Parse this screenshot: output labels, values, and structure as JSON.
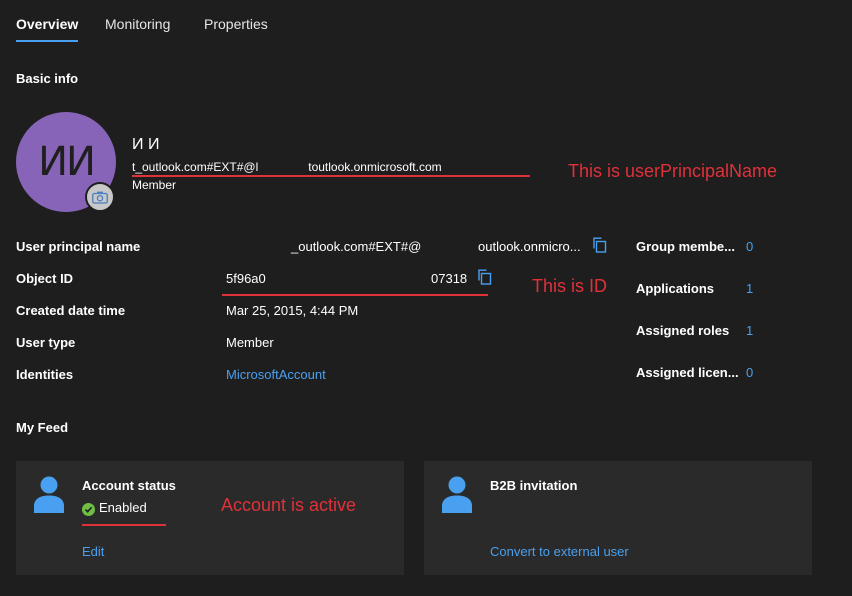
{
  "tabs": [
    {
      "label": "Overview",
      "active": true
    },
    {
      "label": "Monitoring",
      "active": false
    },
    {
      "label": "Properties",
      "active": false
    }
  ],
  "basic_info": {
    "title": "Basic info",
    "avatar_initials": "ИИ",
    "display_name": "И                И",
    "upn_line": "t_outlook.com#EXT#@l               toutlook.onmicrosoft.com",
    "user_type_line": "Member"
  },
  "fields": [
    {
      "label": "User principal name",
      "value_a": "_outlook.com#EXT#@",
      "value_b": "outlook.onmicro..."
    },
    {
      "label": "Object ID",
      "value_a": "5f96a0",
      "value_b": "07318"
    },
    {
      "label": "Created date time",
      "value": "Mar 25, 2015, 4:44 PM"
    },
    {
      "label": "User type",
      "value": "Member"
    },
    {
      "label": "Identities",
      "value": "MicrosoftAccount"
    }
  ],
  "stats": [
    {
      "label": "Group membe...",
      "value": "0"
    },
    {
      "label": "Applications",
      "value": "1"
    },
    {
      "label": "Assigned roles",
      "value": "1"
    },
    {
      "label": "Assigned licen...",
      "value": "0"
    }
  ],
  "feed": {
    "title": "My Feed",
    "cards": [
      {
        "title": "Account status",
        "status": "Enabled",
        "action": "Edit"
      },
      {
        "title": "B2B invitation",
        "action": "Convert to external user"
      }
    ]
  },
  "annotations": {
    "upn": "This is userPrincipalName",
    "id": "This is ID",
    "account": "Account is active"
  },
  "colors": {
    "background": "#1e1e1e",
    "link": "#4aa0f0",
    "annotation_red": "#e0313a",
    "avatar": "#8764b8",
    "enabled_green": "#6ebe44"
  }
}
